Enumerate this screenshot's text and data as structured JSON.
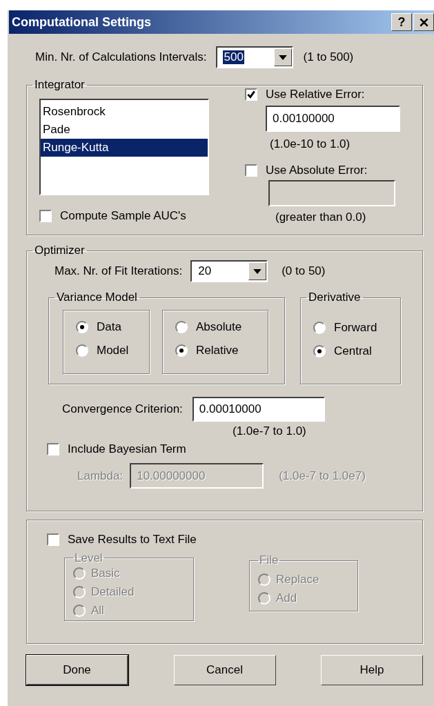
{
  "window": {
    "title": "Computational Settings",
    "help_button": "?"
  },
  "intervals": {
    "label": "Min. Nr. of Calculations Intervals:",
    "value": "500",
    "text_selected": true,
    "range": "(1 to 500)"
  },
  "integrator": {
    "title": "Integrator",
    "methods": [
      {
        "label": "Rosenbrock",
        "selected": false
      },
      {
        "label": "Pade",
        "selected": false
      },
      {
        "label": "Runge-Kutta",
        "selected": true
      }
    ],
    "relative_error": {
      "label": "Use Relative Error:",
      "checked": true,
      "value": "0.00100000",
      "disabled": false,
      "range": "(1.0e-10 to 1.0)"
    },
    "absolute_error": {
      "label": "Use Absolute Error:",
      "checked": false,
      "disabled": true,
      "range": "(greater than 0.0)"
    },
    "compute_auc": {
      "label": "Compute Sample AUC's",
      "checked": false
    }
  },
  "optimizer": {
    "title": "Optimizer",
    "iterations": {
      "label": "Max. Nr. of Fit Iterations:",
      "value": "20",
      "text_selected": false,
      "range": "(0 to 50)"
    },
    "variance_model": {
      "title": "Variance Model",
      "groups": [
        {
          "options": [
            {
              "label": "Data",
              "selected": true
            },
            {
              "label": "Model",
              "selected": false
            }
          ]
        },
        {
          "options": [
            {
              "label": "Absolute",
              "selected": false
            },
            {
              "label": "Relative",
              "selected": true
            }
          ]
        }
      ]
    },
    "derivative": {
      "title": "Derivative",
      "options": [
        {
          "label": "Forward",
          "selected": false
        },
        {
          "label": "Central",
          "selected": true
        }
      ]
    },
    "convergence": {
      "label": "Convergence Criterion:",
      "value": "0.00010000",
      "range": "(1.0e-7 to 1.0)"
    },
    "bayesian": {
      "label": "Include Bayesian Term",
      "checked": false
    },
    "lambda": {
      "label": "Lambda:",
      "value": "10.00000000",
      "range": "(1.0e-7 to 1.0e7)",
      "disabled": true
    }
  },
  "save": {
    "label": "Save Results to Text File",
    "checked": false,
    "level": {
      "title": "Level",
      "disabled": true,
      "options": [
        {
          "label": "Basic",
          "selected": false
        },
        {
          "label": "Detailed",
          "selected": false
        },
        {
          "label": "All",
          "selected": false
        }
      ]
    },
    "file": {
      "title": "File",
      "disabled": true,
      "options": [
        {
          "label": "Replace",
          "selected": false
        },
        {
          "label": "Add",
          "selected": false
        }
      ]
    }
  },
  "buttons": [
    {
      "label": "Done",
      "default": true
    },
    {
      "label": "Cancel",
      "default": false
    },
    {
      "label": "Help",
      "default": false
    }
  ]
}
